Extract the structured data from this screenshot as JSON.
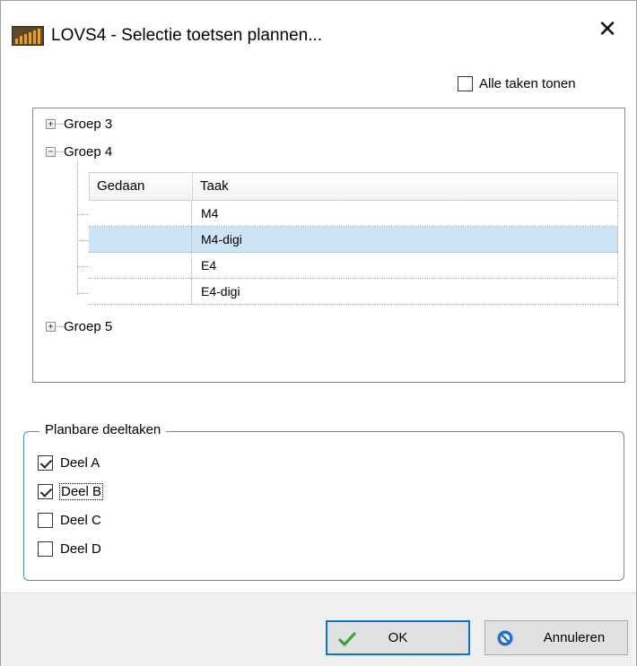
{
  "window": {
    "title": "LOVS4 - Selectie toetsen plannen...",
    "close_glyph": "✕"
  },
  "show_all": {
    "label": "Alle taken tonen",
    "checked": false
  },
  "tree": {
    "groups": [
      {
        "label": "Groep 3",
        "expanded": false,
        "glyph": "+"
      },
      {
        "label": "Groep 4",
        "expanded": true,
        "glyph": "−"
      },
      {
        "label": "Groep 5",
        "expanded": false,
        "glyph": "+"
      }
    ],
    "grid": {
      "headers": [
        "Gedaan",
        "Taak"
      ],
      "rows": [
        {
          "done": "",
          "task": "M4",
          "selected": false
        },
        {
          "done": "",
          "task": "M4-digi",
          "selected": true
        },
        {
          "done": "",
          "task": "E4",
          "selected": false
        },
        {
          "done": "",
          "task": "E4-digi",
          "selected": false
        }
      ]
    }
  },
  "subtasks": {
    "title": "Planbare deeltaken",
    "items": [
      {
        "label": "Deel A",
        "checked": true
      },
      {
        "label": "Deel B",
        "checked": true,
        "focused": true
      },
      {
        "label": "Deel C",
        "checked": false
      },
      {
        "label": "Deel D",
        "checked": false
      }
    ]
  },
  "buttons": {
    "ok": "OK",
    "cancel": "Annuleren"
  },
  "colors": {
    "selection": "#cce4f7",
    "accent": "#0078d7",
    "ok_check": "#3aa53a",
    "cancel_icon": "#1e73d2"
  }
}
